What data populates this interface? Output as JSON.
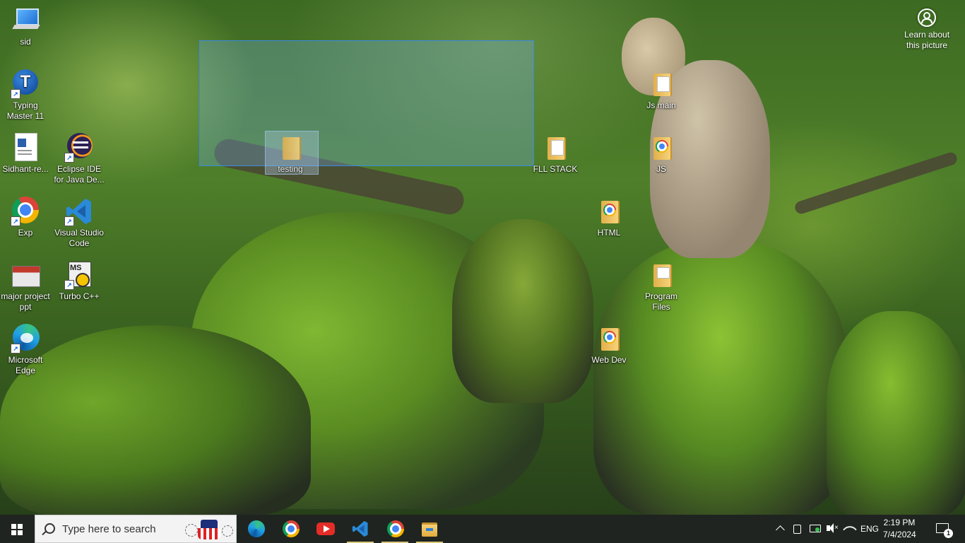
{
  "desktop": {
    "icons": [
      {
        "id": "sid",
        "label": "sid"
      },
      {
        "id": "typing-master",
        "label": "Typing Master 11"
      },
      {
        "id": "sidhant-resume",
        "label": "Sidhant-re..."
      },
      {
        "id": "eclipse",
        "label": "Eclipse IDE for Java De..."
      },
      {
        "id": "exp",
        "label": "Exp"
      },
      {
        "id": "vscode",
        "label": "Visual Studio Code"
      },
      {
        "id": "major-project",
        "label": "major project ppt"
      },
      {
        "id": "turbo-cpp",
        "label": "Turbo C++"
      },
      {
        "id": "edge",
        "label": "Microsoft Edge"
      },
      {
        "id": "testing",
        "label": "testing"
      },
      {
        "id": "fll-stack",
        "label": "FLL STACK"
      },
      {
        "id": "js-main",
        "label": "Js main"
      },
      {
        "id": "js",
        "label": "JS"
      },
      {
        "id": "html",
        "label": "HTML"
      },
      {
        "id": "program-files",
        "label": "Program Files"
      },
      {
        "id": "web-dev",
        "label": "Web Dev"
      }
    ],
    "learn_about": "Learn about this picture"
  },
  "taskbar": {
    "search_placeholder": "Type here to search",
    "apps": [
      "microsoft-edge",
      "google-chrome",
      "youtube",
      "visual-studio-code",
      "google-chrome",
      "file-explorer"
    ],
    "tray": {
      "language": "ENG",
      "time": "2:19 PM",
      "date": "7/4/2024",
      "notifications": "1"
    }
  },
  "colors": {
    "taskbar": "#1f2420",
    "selection": "#3b8ae0",
    "vscode_blue": "#2a8ad8",
    "youtube_red": "#e52d27"
  }
}
